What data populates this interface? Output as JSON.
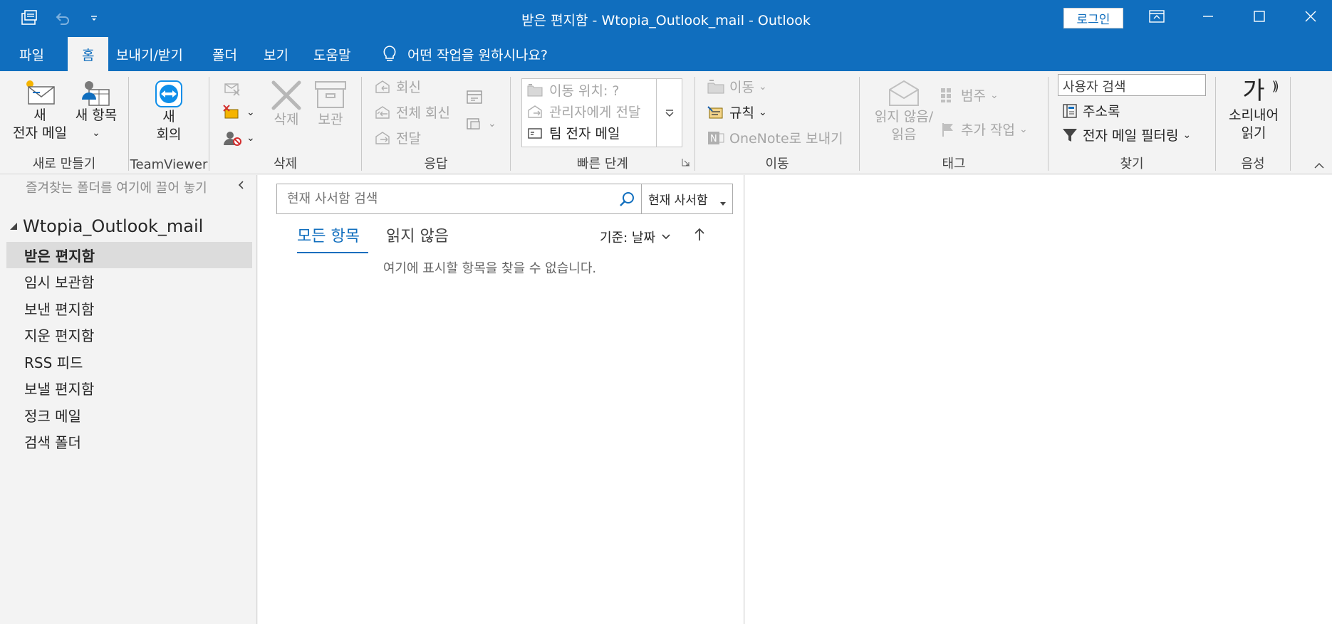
{
  "window": {
    "title": "받은 편지함 - Wtopia_Outlook_mail  -  Outlook",
    "login_label": "로그인"
  },
  "tabs": [
    "파일",
    "홈",
    "보내기/받기",
    "폴더",
    "보기",
    "도움말"
  ],
  "tell_me": "어떤 작업을 원하시나요?",
  "ribbon": {
    "new": {
      "new_email_1": "새",
      "new_email_2": "전자 메일",
      "new_items": "새 항목",
      "label": "새로 만들기"
    },
    "teamviewer": {
      "meeting_1": "새",
      "meeting_2": "회의",
      "label": "TeamViewer"
    },
    "delete": {
      "delete": "삭제",
      "archive": "보관",
      "label": "삭제"
    },
    "respond": {
      "reply": "회신",
      "reply_all": "전체 회신",
      "forward": "전달",
      "label": "응답"
    },
    "quick_steps": {
      "items": [
        "이동 위치: ?",
        "관리자에게 전달",
        "팀 전자 메일"
      ],
      "label": "빠른 단계"
    },
    "move": {
      "move": "이동",
      "rules": "규칙",
      "onenote": "OneNote로 보내기",
      "label": "이동"
    },
    "tags": {
      "unread_read_1": "읽지 않음/",
      "unread_read_2": "읽음",
      "categorize": "범주",
      "follow_up": "추가 작업",
      "label": "태그"
    },
    "find": {
      "search_people": "사용자 검색",
      "address_book": "주소록",
      "filter_email": "전자 메일 필터링",
      "label": "찾기"
    },
    "speech": {
      "glyph": "가",
      "read_aloud_1": "소리내어",
      "read_aloud_2": "읽기",
      "label": "음성"
    }
  },
  "folder_pane": {
    "favorites_hint": "즐겨찾는 폴더를 여기에 끌어 놓기",
    "account": "Wtopia_Outlook_mail",
    "folders": [
      "받은 편지함",
      "임시 보관함",
      "보낸 편지함",
      "지운 편지함",
      "RSS 피드",
      "보낼 편지함",
      "정크 메일",
      "검색 폴더"
    ]
  },
  "message_list": {
    "search_placeholder": "현재 사서함 검색",
    "scope": "현재 사서함",
    "tab_all": "모든 항목",
    "tab_unread": "읽지 않음",
    "sort_by": "기준: 날짜",
    "empty_message": "여기에 표시할 항목을 찾을 수 없습니다."
  },
  "colors": {
    "accent": "#106ebe",
    "selected_folder_bg": "#dcdcdc"
  }
}
